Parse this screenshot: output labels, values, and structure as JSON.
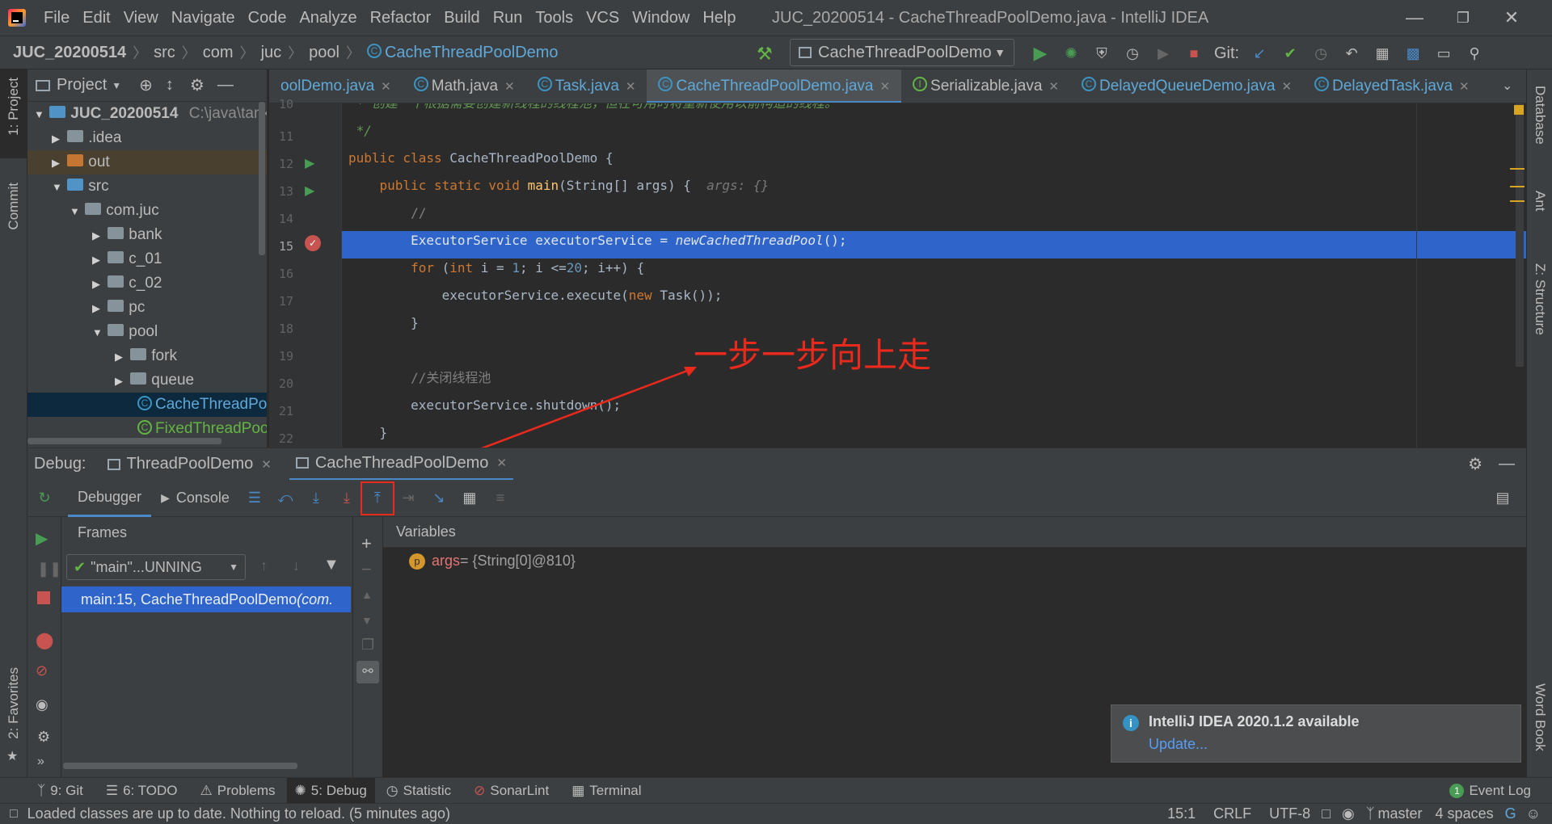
{
  "menubar": {
    "items": [
      "File",
      "Edit",
      "View",
      "Navigate",
      "Code",
      "Analyze",
      "Refactor",
      "Build",
      "Run",
      "Tools",
      "VCS",
      "Window",
      "Help"
    ],
    "window_title": "JUC_20200514 - CacheThreadPoolDemo.java - IntelliJ IDEA"
  },
  "navbar": {
    "breadcrumbs": [
      "JUC_20200514",
      "src",
      "com",
      "juc",
      "pool",
      "CacheThreadPoolDemo"
    ],
    "run_config": "CacheThreadPoolDemo",
    "git_label": "Git:"
  },
  "left_strip": {
    "project": "1: Project",
    "commit": "Commit",
    "favorites": "2: Favorites"
  },
  "right_strip": {
    "database": "Database",
    "ant": "Ant",
    "structure": "Z: Structure",
    "word_book": "Word Book"
  },
  "project": {
    "title": "Project",
    "tree": [
      {
        "label": "JUC_20200514",
        "hint": "C:\\java\\tank"
      },
      {
        "label": ".idea"
      },
      {
        "label": "out"
      },
      {
        "label": "src"
      },
      {
        "label": "com.juc"
      },
      {
        "label": "bank"
      },
      {
        "label": "c_01"
      },
      {
        "label": "c_02"
      },
      {
        "label": "pc"
      },
      {
        "label": "pool"
      },
      {
        "label": "fork"
      },
      {
        "label": "queue"
      },
      {
        "label": "CacheThreadPo"
      },
      {
        "label": "FixedThreadPoo"
      }
    ]
  },
  "editor": {
    "tabs": [
      "oolDemo.java",
      "Math.java",
      "Task.java",
      "CacheThreadPoolDemo.java",
      "Serializable.java",
      "DelayedQueueDemo.java",
      "DelayedTask.java"
    ],
    "line_numbers": [
      "10",
      "11",
      "12",
      "13",
      "14",
      "15",
      "16",
      "17",
      "18",
      "19",
      "20",
      "21",
      "22"
    ],
    "lines": {
      "l10": " * 创建一个根据需要创建新线程的线程池，但在可用时将重新使用以前构造的线程。",
      "l11": " */",
      "l12_kw": "public class ",
      "l12_name": "CacheThreadPoolDemo {",
      "l13_kw": "    public static void ",
      "l13_fn": "main",
      "l13_rest": "(String[] args) {  ",
      "l13_hint": "args: {}",
      "l14": "        //",
      "l15_a": "        ExecutorService executorService = ",
      "l15_b": "newCachedThreadPool",
      "l15_c": "();",
      "l16_a": "        ",
      "l16_for": "for",
      "l16_b": " (",
      "l16_int": "int",
      "l16_c": " i = ",
      "l16_one": "1",
      "l16_d": "; i <=",
      "l16_twenty": "20",
      "l16_e": "; i++) {",
      "l17_a": "            executorService.execute(",
      "l17_new": "new",
      "l17_b": " Task());",
      "l18": "        }",
      "l20": "        //关闭线程池",
      "l21": "        executorService.shutdown();",
      "l22": "    }"
    }
  },
  "annotation": {
    "text": "一步一步向上走",
    "color": "#e8291c"
  },
  "debug": {
    "label": "Debug:",
    "tabs": [
      "ThreadPoolDemo",
      "CacheThreadPoolDemo"
    ],
    "debugger_tab": "Debugger",
    "console_tab": "Console",
    "frames_title": "Frames",
    "thread_select": "\"main\"...UNNING",
    "frame_row_main": "main:15, CacheThreadPoolDemo",
    "frame_row_pkg": " (com.",
    "variables_title": "Variables",
    "var_name": "args",
    "var_value": " = {String[0]@810}",
    "var_badge": "p"
  },
  "notification": {
    "title": "IntelliJ IDEA 2020.1.2 available",
    "link": "Update..."
  },
  "bottom_tools": [
    "9: Git",
    "6: TODO",
    "Problems",
    "5: Debug",
    "Statistic",
    "SonarLint",
    "Terminal"
  ],
  "event_log": {
    "badge": "1",
    "label": "Event Log"
  },
  "status": {
    "message": "Loaded classes are up to date. Nothing to reload. (5 minutes ago)",
    "position": "15:1",
    "line_sep": "CRLF",
    "encoding": "UTF-8",
    "branch": "master",
    "indent": "4 spaces"
  },
  "colors": {
    "accent": "#4a88c7",
    "selection": "#2f65ca",
    "annotation_red": "#e8291c"
  }
}
